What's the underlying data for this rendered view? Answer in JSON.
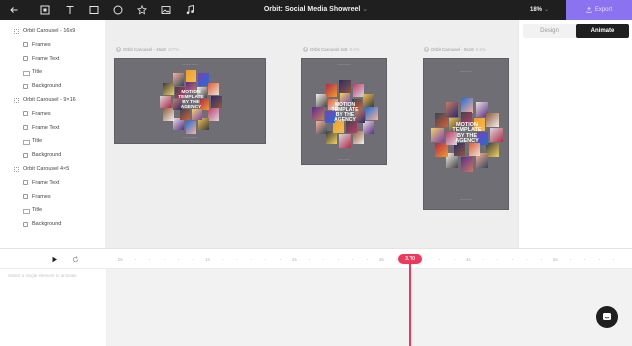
{
  "toolbar": {
    "tools": [
      "back-arrow-icon",
      "select-frame-icon",
      "text-tool-icon",
      "rectangle-tool-icon",
      "circle-tool-icon",
      "star-tool-icon",
      "image-tool-icon",
      "music-tool-icon"
    ],
    "document_title": "Orbit: Social Media Showreel",
    "title_chevron": "⌄",
    "zoom": "18%",
    "zoom_chevron": "⌄",
    "export_label": "Export",
    "export_color": "#8a72f0"
  },
  "layers": [
    {
      "label": "Orbit Carousel - 16x9",
      "level": 0,
      "icon": "grid-frame-icon"
    },
    {
      "label": "Frames",
      "level": 1,
      "icon": "frame-group-icon"
    },
    {
      "label": "Frame Text",
      "level": 1,
      "icon": "frame-group-icon"
    },
    {
      "label": "Title",
      "level": 1,
      "icon": "text-layer-icon"
    },
    {
      "label": "Background",
      "level": 1,
      "icon": "background-layer-icon"
    },
    {
      "label": "Orbit Carousel - 9×16",
      "level": 0,
      "icon": "grid-frame-icon"
    },
    {
      "label": "Frames",
      "level": 1,
      "icon": "frame-group-icon"
    },
    {
      "label": "Frame Text",
      "level": 1,
      "icon": "frame-group-icon"
    },
    {
      "label": "Title",
      "level": 1,
      "icon": "text-layer-icon"
    },
    {
      "label": "Background",
      "level": 1,
      "icon": "background-layer-icon"
    },
    {
      "label": "Orbit Carousel 4×5",
      "level": 0,
      "icon": "grid-frame-icon"
    },
    {
      "label": "Frame Text",
      "level": 1,
      "icon": "frame-group-icon"
    },
    {
      "label": "Frames",
      "level": 1,
      "icon": "frame-group-icon"
    },
    {
      "label": "Title",
      "level": 1,
      "icon": "text-layer-icon"
    },
    {
      "label": "Background",
      "level": 1,
      "icon": "background-layer-icon"
    }
  ],
  "canvas": {
    "frames": [
      {
        "label": "Orbit Carousel - 16x9",
        "pct": "107%",
        "title_lines": [
          "MOTION",
          "TEMPLATE",
          "BY THE",
          "AGENCY"
        ]
      },
      {
        "label": "Orbit Carousel 4x5",
        "pct": "9.5%",
        "title_lines": [
          "MOTION",
          "TEMPLATE",
          "BY THE",
          "AGENCY"
        ]
      },
      {
        "label": "Orbit Carousel - 9x16",
        "pct": "9.5%",
        "title_lines": [
          "MOTION",
          "TEMPLATE",
          "BY THE",
          "AGENCY"
        ]
      }
    ]
  },
  "right_panel": {
    "tabs": [
      {
        "label": "Design",
        "active": false
      },
      {
        "label": "Animate",
        "active": true
      }
    ]
  },
  "timeline": {
    "ruler_labels": [
      "0s",
      "1s",
      "2s",
      "3s",
      "4s",
      "5s"
    ],
    "current_time": "3.30",
    "hint": "Select a single element to animate"
  },
  "colors": {
    "accent": "#f0385c",
    "topbar": "#1f1f1f",
    "frame_bg": "#6e6e74",
    "canvas_bg": "#eeeeee"
  }
}
